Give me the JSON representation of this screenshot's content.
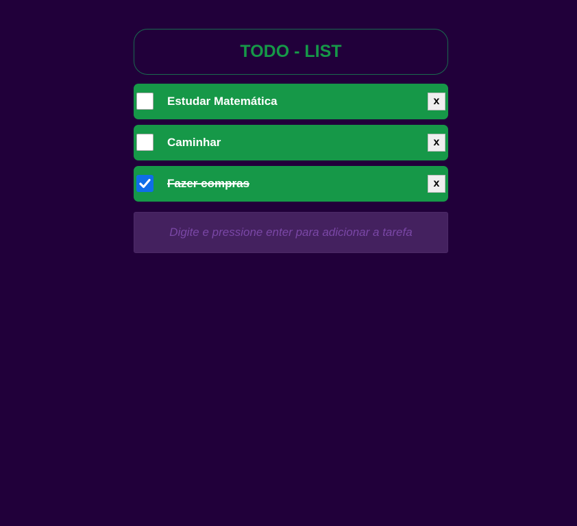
{
  "header": {
    "title": "TODO - LIST"
  },
  "tasks": [
    {
      "label": "Estudar Matemática",
      "done": false,
      "delete_label": "x"
    },
    {
      "label": "Caminhar",
      "done": false,
      "delete_label": "x"
    },
    {
      "label": "Fazer compras",
      "done": true,
      "delete_label": "x"
    }
  ],
  "input": {
    "placeholder": "Digite e pressione enter para adicionar a tarefa",
    "value": ""
  },
  "colors": {
    "background": "#21003a",
    "accent": "#169848",
    "checkbox_checked": "#0f6ee8",
    "input_background": "#44215f",
    "placeholder": "#7a47a6"
  }
}
